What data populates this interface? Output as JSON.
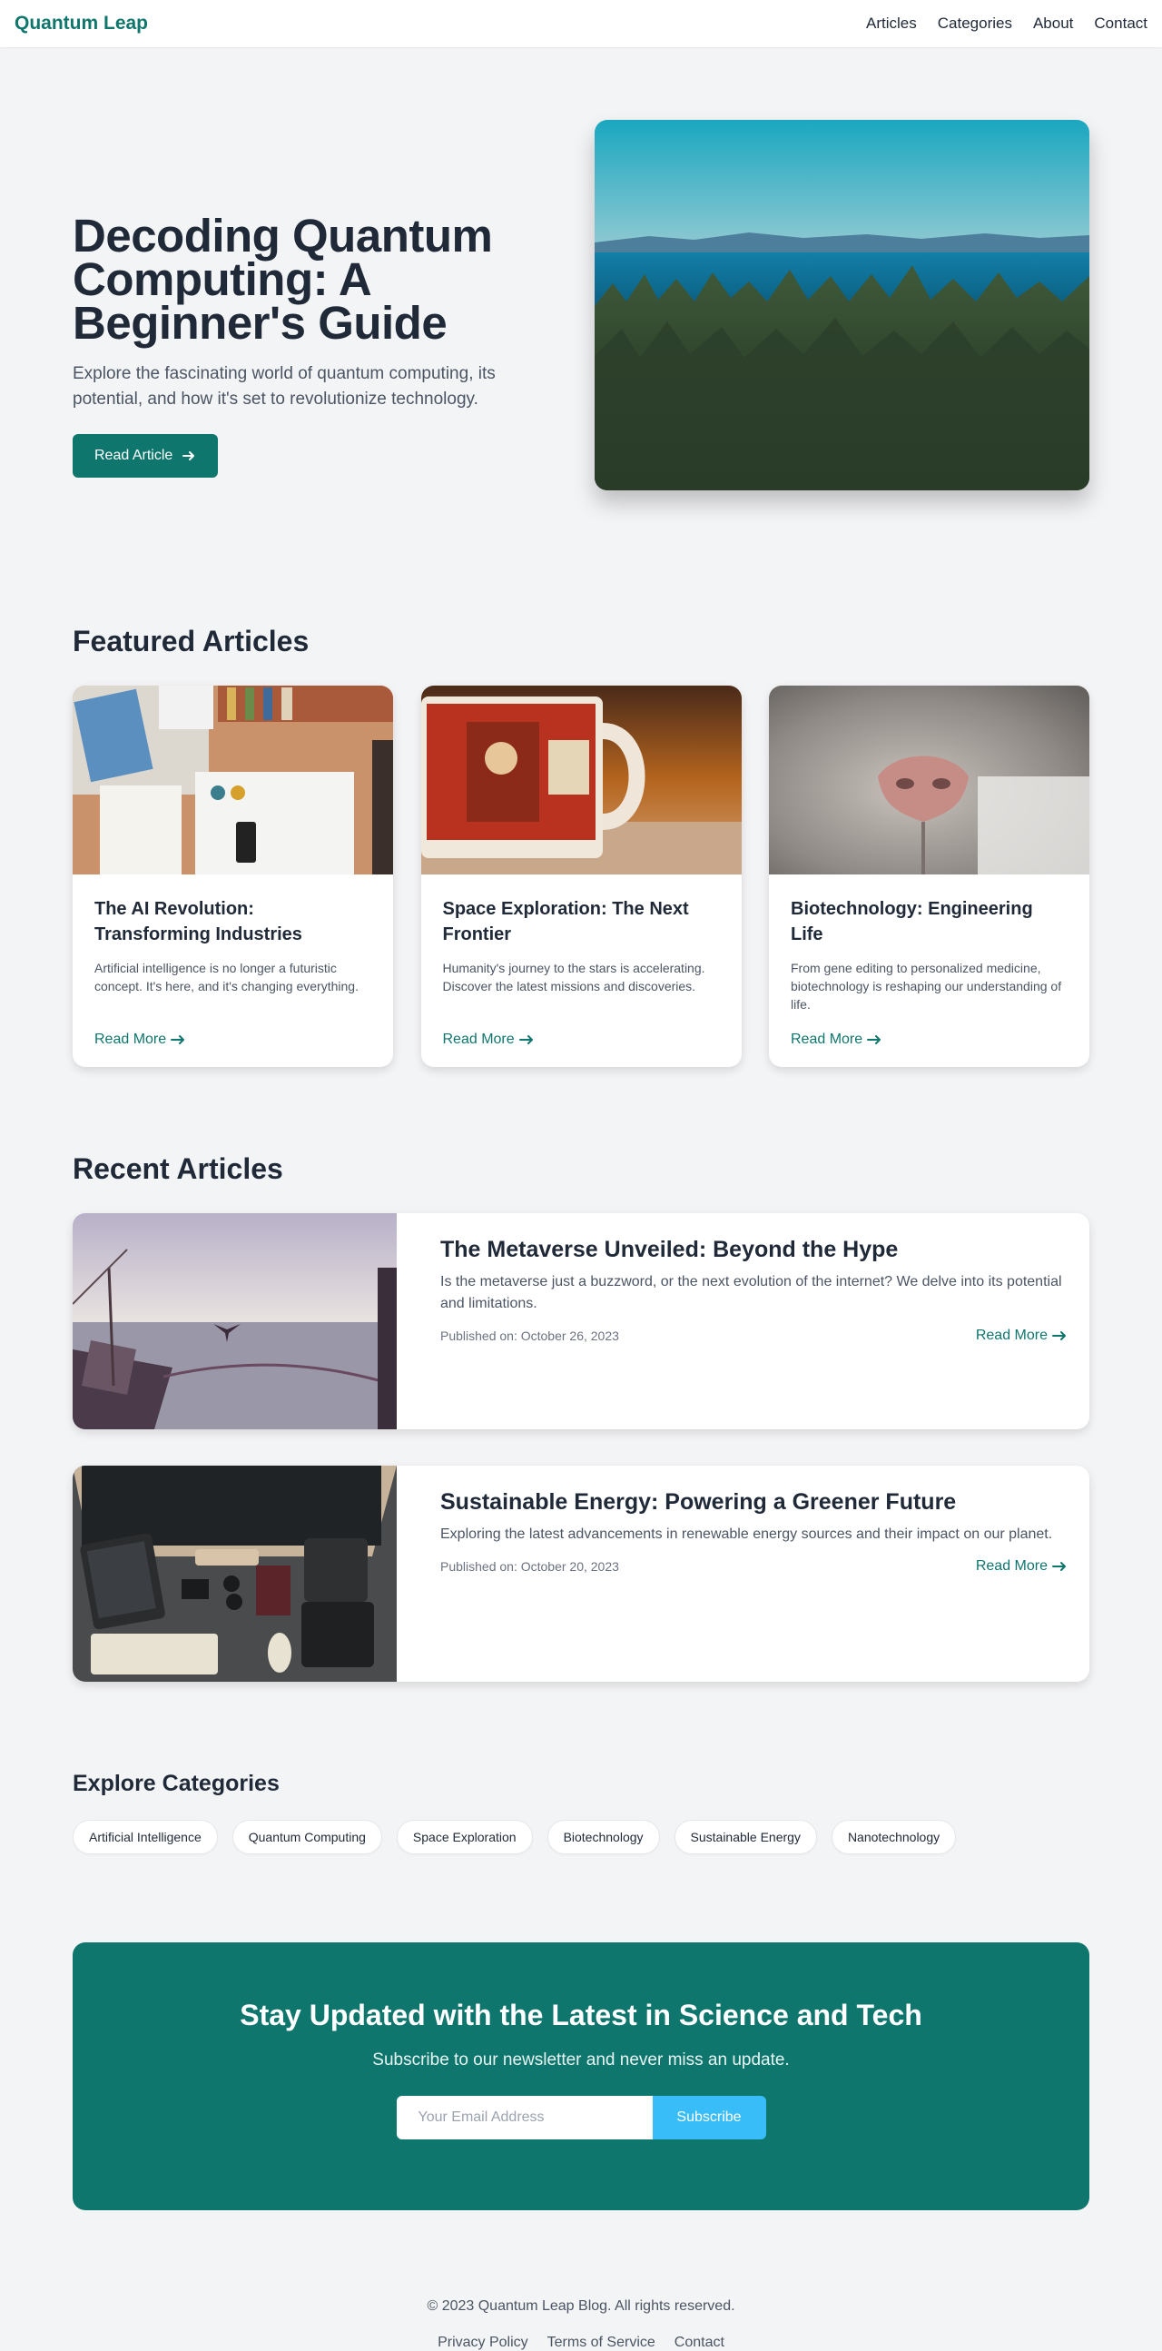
{
  "nav": {
    "brand": "Quantum Leap",
    "links": [
      "Articles",
      "Categories",
      "About",
      "Contact"
    ]
  },
  "hero": {
    "title": "Decoding Quantum Computing: A Beginner's Guide",
    "description": "Explore the fascinating world of quantum computing, its potential, and how it's set to revolutionize technology.",
    "button_label": "Read Article"
  },
  "featured": {
    "heading": "Featured Articles",
    "cards": [
      {
        "title": "The AI Revolution: Transforming Industries",
        "description": "Artificial intelligence is no longer a futuristic concept. It's here, and it's changing everything.",
        "link": "Read More"
      },
      {
        "title": "Space Exploration: The Next Frontier",
        "description": "Humanity's journey to the stars is accelerating. Discover the latest missions and discoveries.",
        "link": "Read More"
      },
      {
        "title": "Biotechnology: Engineering Life",
        "description": "From gene editing to personalized medicine, biotechnology is reshaping our understanding of life.",
        "link": "Read More"
      }
    ]
  },
  "recent": {
    "heading": "Recent Articles",
    "items": [
      {
        "title": "The Metaverse Unveiled: Beyond the Hype",
        "description": "Is the metaverse just a buzzword, or the next evolution of the internet? We delve into its potential and limitations.",
        "date": "Published on: October 26, 2023",
        "link": "Read More"
      },
      {
        "title": "Sustainable Energy: Powering a Greener Future",
        "description": "Exploring the latest advancements in renewable energy sources and their impact on our planet.",
        "date": "Published on: October 20, 2023",
        "link": "Read More"
      }
    ]
  },
  "categories": {
    "heading": "Explore Categories",
    "items": [
      "Artificial Intelligence",
      "Quantum Computing",
      "Space Exploration",
      "Biotechnology",
      "Sustainable Energy",
      "Nanotechnology"
    ]
  },
  "newsletter": {
    "title": "Stay Updated with the Latest in Science and Tech",
    "subtitle": "Subscribe to our newsletter and never miss an update.",
    "placeholder": "Your Email Address",
    "button_label": "Subscribe"
  },
  "footer": {
    "copyright": "© 2023 Quantum Leap Blog. All rights reserved.",
    "links": [
      "Privacy Policy",
      "Terms of Service",
      "Contact"
    ]
  },
  "icons": {
    "arrow": "arrow-right-icon"
  },
  "colors": {
    "brand": "#0f766e",
    "accent": "#38bdf8",
    "background": "#f3f4f6"
  }
}
